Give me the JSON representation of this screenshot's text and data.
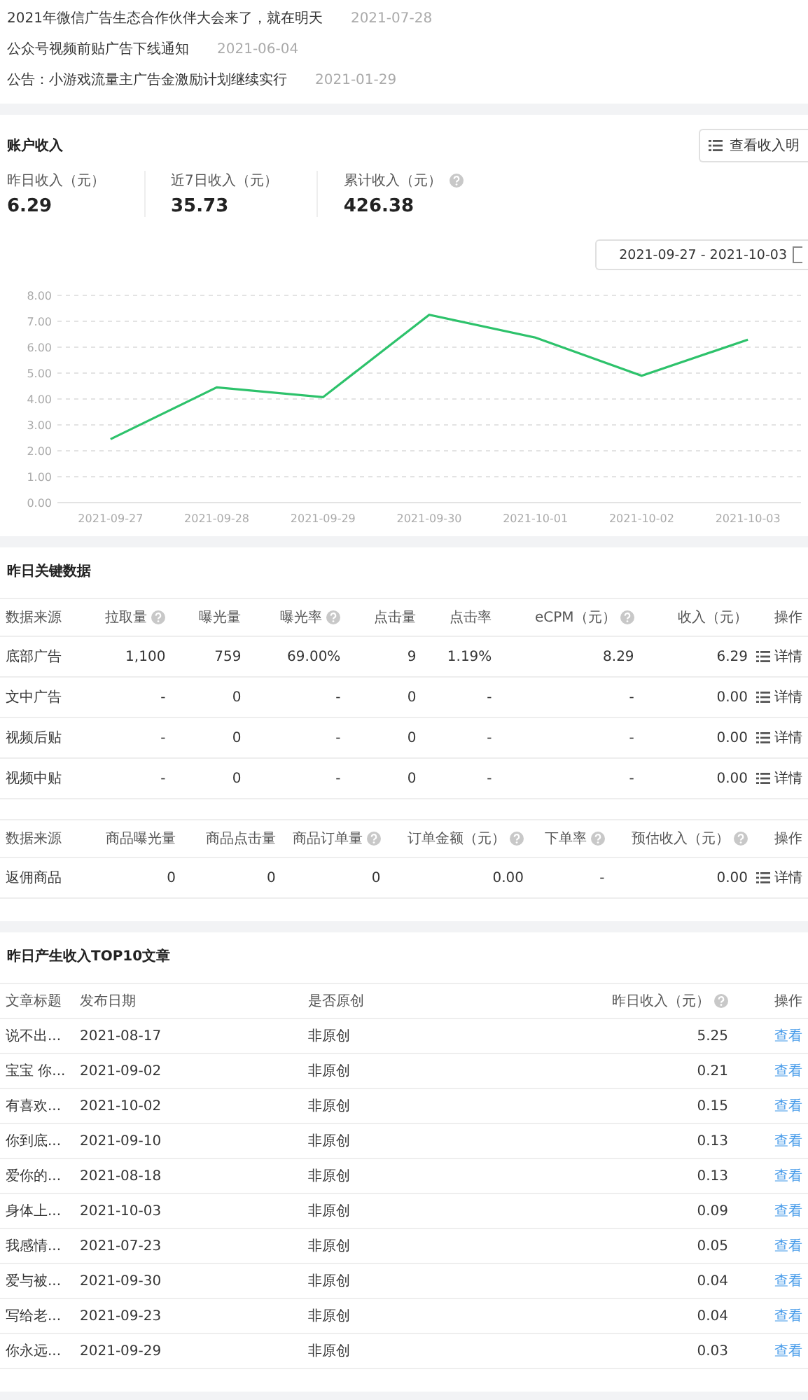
{
  "notices": [
    {
      "title": "2021年微信广告生态合作伙伴大会来了，就在明天",
      "date": "2021-07-28"
    },
    {
      "title": "公众号视频前贴广告下线通知",
      "date": "2021-06-04"
    },
    {
      "title": "公告：小游戏流量主广告金激励计划继续实行",
      "date": "2021-01-29"
    }
  ],
  "income": {
    "title": "账户收入",
    "detail_button": "查看收入明",
    "stats": [
      {
        "label": "昨日收入（元）",
        "value": "6.29",
        "help": false
      },
      {
        "label": "近7日收入（元）",
        "value": "35.73",
        "help": false
      },
      {
        "label": "累计收入（元）",
        "value": "426.38",
        "help": true
      }
    ],
    "date_range": "2021-09-27 - 2021-10-03",
    "chart_data": {
      "type": "line",
      "categories": [
        "2021-09-27",
        "2021-09-28",
        "2021-09-29",
        "2021-09-30",
        "2021-10-01",
        "2021-10-02",
        "2021-10-03"
      ],
      "series": [
        {
          "color": "#2dc26b",
          "values": [
            2.45,
            4.45,
            4.07,
            7.25,
            6.37,
            4.9,
            6.29
          ]
        }
      ],
      "grid": true,
      "ylim": [
        0,
        8
      ],
      "yticks": [
        {
          "value": 0,
          "label": "0.00"
        },
        {
          "value": 1,
          "label": "1.00"
        },
        {
          "value": 2,
          "label": "2.00"
        },
        {
          "value": 3,
          "label": "3.00"
        },
        {
          "value": 4,
          "label": "4.00"
        },
        {
          "value": 5,
          "label": "5.00"
        },
        {
          "value": 6,
          "label": "6.00"
        },
        {
          "value": 7,
          "label": "7.00"
        },
        {
          "value": 8,
          "label": "8.00"
        }
      ]
    }
  },
  "key_data": {
    "title": "昨日关键数据",
    "tables": [
      {
        "columns": [
          {
            "label": "数据来源",
            "help": false
          },
          {
            "label": "拉取量",
            "help": true
          },
          {
            "label": "曝光量",
            "help": false
          },
          {
            "label": "曝光率",
            "help": true
          },
          {
            "label": "点击量",
            "help": false
          },
          {
            "label": "点击率",
            "help": false
          },
          {
            "label": "eCPM（元）",
            "help": true
          },
          {
            "label": "收入（元）",
            "help": false
          },
          {
            "label": "操作",
            "help": false
          }
        ],
        "rows": [
          {
            "cells": [
              "底部广告",
              "1,100",
              "759",
              "69.00%",
              "9",
              "1.19%",
              "8.29",
              "6.29"
            ],
            "action": "详情"
          },
          {
            "cells": [
              "文中广告",
              "-",
              "0",
              "-",
              "0",
              "-",
              "-",
              "0.00"
            ],
            "action": "详情"
          },
          {
            "cells": [
              "视频后贴",
              "-",
              "0",
              "-",
              "0",
              "-",
              "-",
              "0.00"
            ],
            "action": "详情"
          },
          {
            "cells": [
              "视频中贴",
              "-",
              "0",
              "-",
              "0",
              "-",
              "-",
              "0.00"
            ],
            "action": "详情"
          }
        ]
      },
      {
        "columns": [
          {
            "label": "数据来源",
            "help": false
          },
          {
            "label": "商品曝光量",
            "help": false
          },
          {
            "label": "商品点击量",
            "help": false
          },
          {
            "label": "商品订单量",
            "help": true
          },
          {
            "label": "订单金额（元）",
            "help": true
          },
          {
            "label": "下单率",
            "help": true
          },
          {
            "label": "预估收入（元）",
            "help": true
          },
          {
            "label": "操作",
            "help": false
          }
        ],
        "rows": [
          {
            "cells": [
              "返佣商品",
              "0",
              "0",
              "0",
              "0.00",
              "-",
              "0.00"
            ],
            "action": "详情"
          }
        ]
      }
    ]
  },
  "top10": {
    "title": "昨日产生收入TOP10文章",
    "columns": [
      {
        "label": "文章标题",
        "help": false
      },
      {
        "label": "发布日期",
        "help": false
      },
      {
        "label": "是否原创",
        "help": false
      },
      {
        "label": "昨日收入（元）",
        "help": true
      },
      {
        "label": "操作",
        "help": false
      }
    ],
    "rows": [
      {
        "cells": [
          "说不出...",
          "2021-08-17",
          "非原创",
          "5.25"
        ],
        "action": "查看"
      },
      {
        "cells": [
          "宝宝 你...",
          "2021-09-02",
          "非原创",
          "0.21"
        ],
        "action": "查看"
      },
      {
        "cells": [
          "有喜欢...",
          "2021-10-02",
          "非原创",
          "0.15"
        ],
        "action": "查看"
      },
      {
        "cells": [
          "你到底...",
          "2021-09-10",
          "非原创",
          "0.13"
        ],
        "action": "查看"
      },
      {
        "cells": [
          "爱你的...",
          "2021-08-18",
          "非原创",
          "0.13"
        ],
        "action": "查看"
      },
      {
        "cells": [
          "身体上...",
          "2021-10-03",
          "非原创",
          "0.09"
        ],
        "action": "查看"
      },
      {
        "cells": [
          "我感情...",
          "2021-07-23",
          "非原创",
          "0.05"
        ],
        "action": "查看"
      },
      {
        "cells": [
          "爱与被...",
          "2021-09-30",
          "非原创",
          "0.04"
        ],
        "action": "查看"
      },
      {
        "cells": [
          "写给老...",
          "2021-09-23",
          "非原创",
          "0.04"
        ],
        "action": "查看"
      },
      {
        "cells": [
          "你永远...",
          "2021-09-29",
          "非原创",
          "0.03"
        ],
        "action": "查看"
      }
    ]
  }
}
